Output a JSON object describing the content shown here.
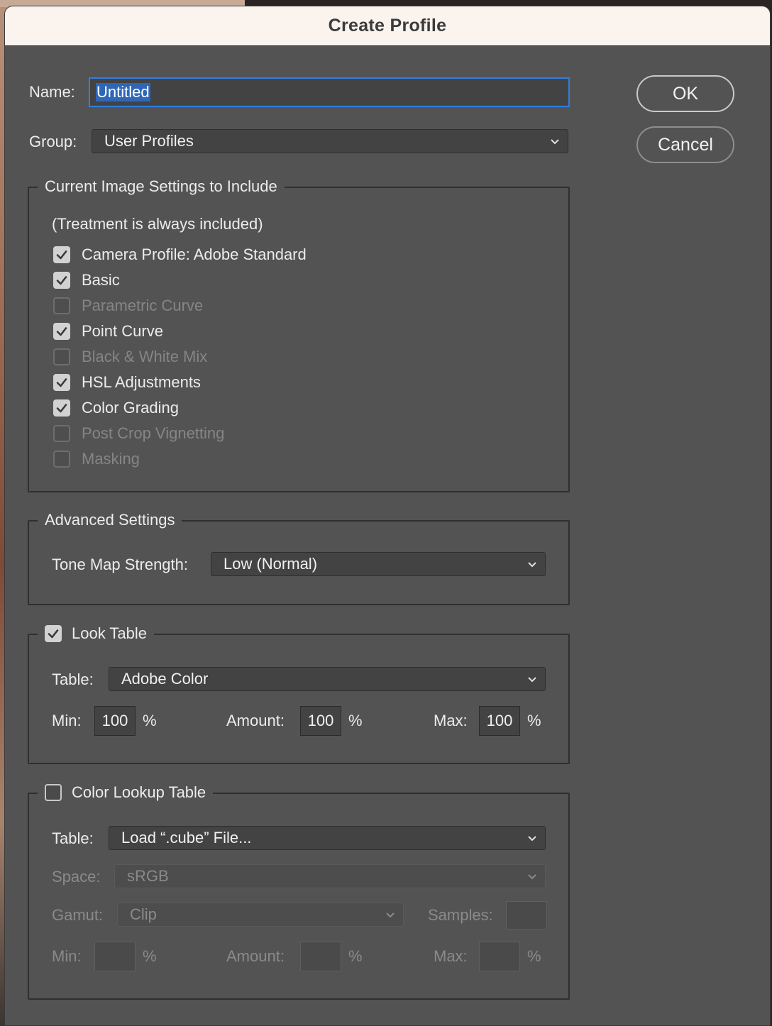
{
  "dialog": {
    "title": "Create Profile"
  },
  "name": {
    "label": "Name:",
    "value": "Untitled"
  },
  "group": {
    "label": "Group:",
    "value": "User Profiles"
  },
  "buttons": {
    "ok": "OK",
    "cancel": "Cancel"
  },
  "settings_include": {
    "legend": "Current Image Settings to Include",
    "note": "(Treatment is always included)",
    "items": [
      {
        "label": "Camera Profile: Adobe Standard",
        "checked": true,
        "enabled": true
      },
      {
        "label": "Basic",
        "checked": true,
        "enabled": true
      },
      {
        "label": "Parametric Curve",
        "checked": false,
        "enabled": false
      },
      {
        "label": "Point Curve",
        "checked": true,
        "enabled": true
      },
      {
        "label": "Black & White Mix",
        "checked": false,
        "enabled": false
      },
      {
        "label": "HSL Adjustments",
        "checked": true,
        "enabled": true
      },
      {
        "label": "Color Grading",
        "checked": true,
        "enabled": true
      },
      {
        "label": "Post Crop Vignetting",
        "checked": false,
        "enabled": false
      },
      {
        "label": "Masking",
        "checked": false,
        "enabled": false
      }
    ]
  },
  "advanced": {
    "legend": "Advanced Settings",
    "tone_map_label": "Tone Map Strength:",
    "tone_map_value": "Low (Normal)"
  },
  "look_table": {
    "legend": "Look Table",
    "checked": true,
    "table_label": "Table:",
    "table_value": "Adobe Color",
    "min_label": "Min:",
    "min_value": "100",
    "amount_label": "Amount:",
    "amount_value": "100",
    "max_label": "Max:",
    "max_value": "100",
    "percent": "%"
  },
  "color_lookup": {
    "legend": "Color Lookup Table",
    "checked": false,
    "table_label": "Table:",
    "table_value": "Load “.cube” File...",
    "space_label": "Space:",
    "space_value": "sRGB",
    "gamut_label": "Gamut:",
    "gamut_value": "Clip",
    "samples_label": "Samples:",
    "samples_value": "",
    "min_label": "Min:",
    "min_value": "",
    "amount_label": "Amount:",
    "amount_value": "",
    "max_label": "Max:",
    "max_value": "",
    "percent": "%"
  }
}
